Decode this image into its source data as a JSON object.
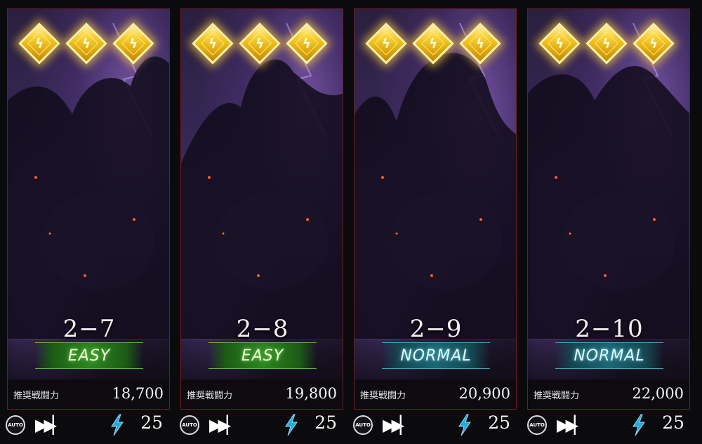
{
  "cards": [
    {
      "stage": "2−7",
      "difficulty": "EASY",
      "difficulty_kind": "easy",
      "power_label": "推奨戦闘力",
      "power": "18,700",
      "auto_label": "AUTO",
      "energy": "25",
      "stars": 3
    },
    {
      "stage": "2−8",
      "difficulty": "EASY",
      "difficulty_kind": "easy",
      "power_label": "推奨戦闘力",
      "power": "19,800",
      "auto_label": "AUTO",
      "energy": "25",
      "stars": 3
    },
    {
      "stage": "2−9",
      "difficulty": "NORMAL",
      "difficulty_kind": "normal",
      "power_label": "推奨戦闘力",
      "power": "20,900",
      "auto_label": "AUTO",
      "energy": "25",
      "stars": 3
    },
    {
      "stage": "2−10",
      "difficulty": "NORMAL",
      "difficulty_kind": "normal",
      "power_label": "推奨戦闘力",
      "power": "22,000",
      "auto_label": "AUTO",
      "energy": "25",
      "stars": 3
    }
  ],
  "icons": {
    "rank_gem": "lightning-gem-icon",
    "auto": "auto-battle-icon",
    "skip": "fast-forward-icon",
    "energy": "lightning-bolt-icon"
  },
  "colors": {
    "easy": "#2e8520",
    "normal": "#1d6674",
    "gem": "#f5c518",
    "bolt": "#29a9d6",
    "card_border": "#6a1e24"
  }
}
